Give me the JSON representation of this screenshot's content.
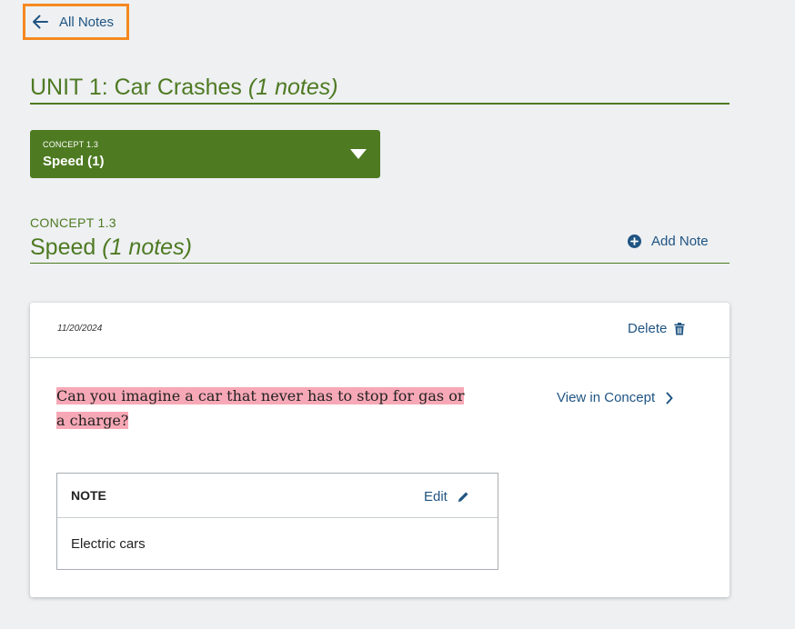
{
  "nav": {
    "back_label": "All Notes"
  },
  "unit": {
    "title": "UNIT 1: Car Crashes",
    "count_label": "(1 notes)"
  },
  "concept_select": {
    "eyebrow": "CONCEPT 1.3",
    "selected": "Speed (1)"
  },
  "concept": {
    "eyebrow": "CONCEPT 1.3",
    "title": "Speed",
    "count_label": "(1 notes)",
    "add_note_label": "Add Note"
  },
  "note_card": {
    "date": "11/20/2024",
    "delete_label": "Delete",
    "highlight_text": "Can you imagine a car that never has to stop for gas or a charge?",
    "view_in_concept_label": "View in Concept",
    "note_label": "NOTE",
    "edit_label": "Edit",
    "note_text": "Electric cars"
  },
  "colors": {
    "accent_green": "#4e7a22",
    "link_blue": "#1f5482",
    "highlight_pink": "#f7a8b6",
    "focus_orange": "#f5891f"
  },
  "icons": {
    "back": "arrow-left-icon",
    "add": "plus-circle-icon",
    "delete": "trash-icon",
    "view": "chevron-right-icon",
    "edit": "pencil-icon",
    "dropdown": "caret-down-icon"
  }
}
